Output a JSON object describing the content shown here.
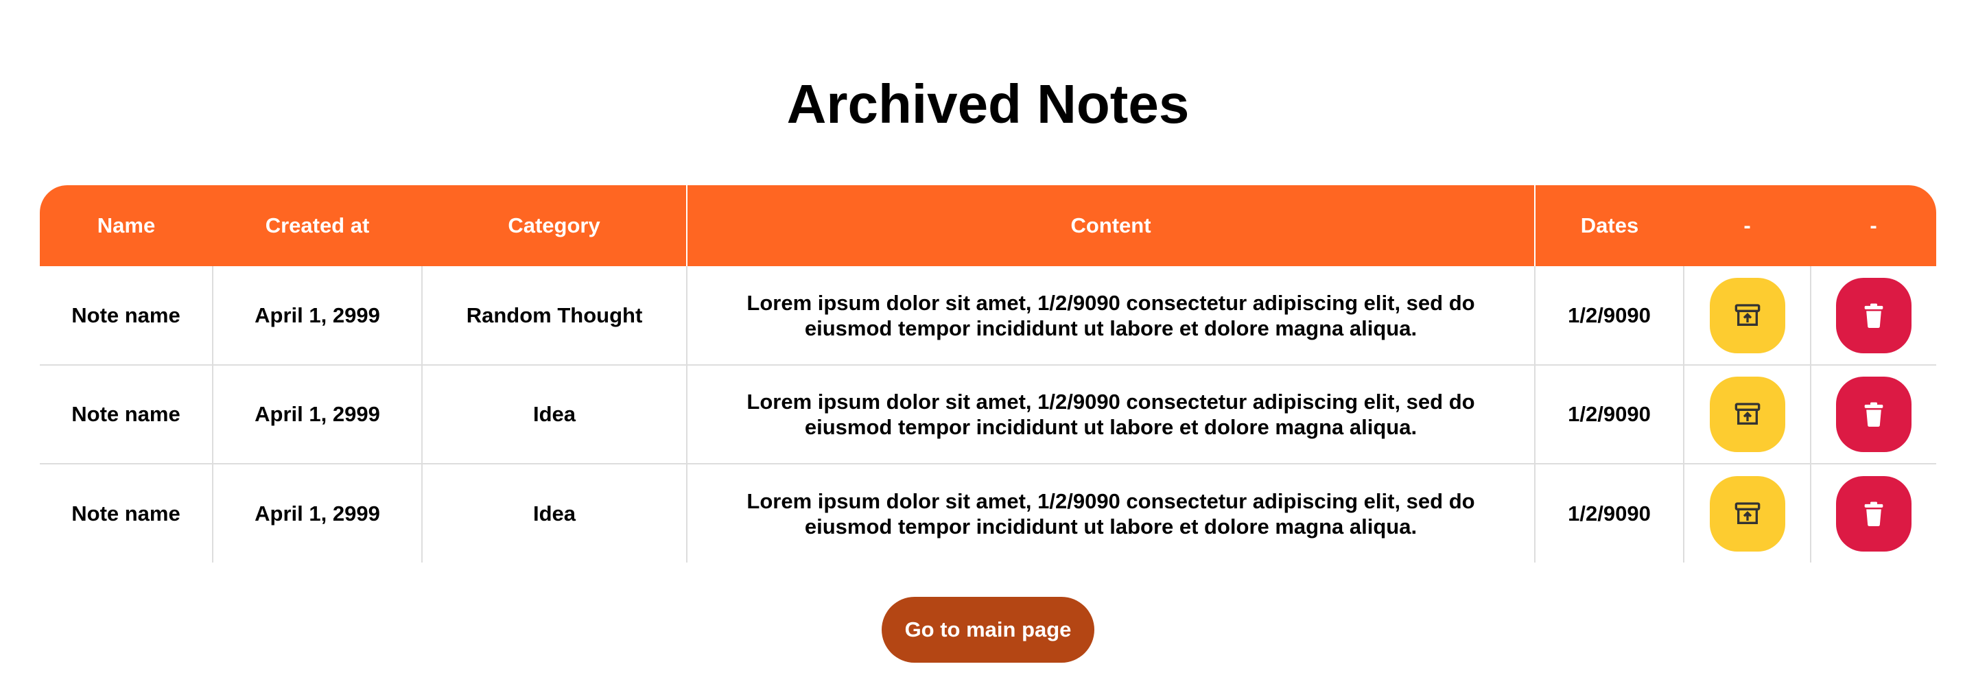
{
  "page": {
    "title": "Archived Notes"
  },
  "table": {
    "headers": [
      "Name",
      "Created at",
      "Category",
      "Content",
      "Dates",
      "-",
      "-"
    ],
    "rows": [
      {
        "name": "Note name",
        "created": "April 1, 2999",
        "category": "Random Thought",
        "content": "Lorem ipsum dolor sit amet, 1/2/9090 consectetur adipiscing elit, sed do eiusmod tempor incididunt ut labore et dolore magna aliqua.",
        "dates": "1/2/9090",
        "unarchive_icon": "unarchive-icon",
        "delete_icon": "trash-icon"
      },
      {
        "name": "Note name",
        "created": "April 1, 2999",
        "category": "Idea",
        "content": "Lorem ipsum dolor sit amet, 1/2/9090 consectetur adipiscing elit, sed do eiusmod tempor incididunt ut labore et dolore magna aliqua.",
        "dates": "1/2/9090",
        "unarchive_icon": "unarchive-icon",
        "delete_icon": "trash-icon"
      },
      {
        "name": "Note name",
        "created": "April 1, 2999",
        "category": "Idea",
        "content": "Lorem ipsum dolor sit amet, 1/2/9090 consectetur adipiscing elit, sed do eiusmod tempor incididunt ut labore et dolore magna aliqua.",
        "dates": "1/2/9090",
        "unarchive_icon": "unarchive-icon",
        "delete_icon": "trash-icon"
      }
    ]
  },
  "footer": {
    "main_page_label": "Go to main page"
  },
  "colors": {
    "header": "#ff6622",
    "unarchive": "#fdcc30",
    "delete": "#dc1a44",
    "main_button": "#b44614"
  }
}
